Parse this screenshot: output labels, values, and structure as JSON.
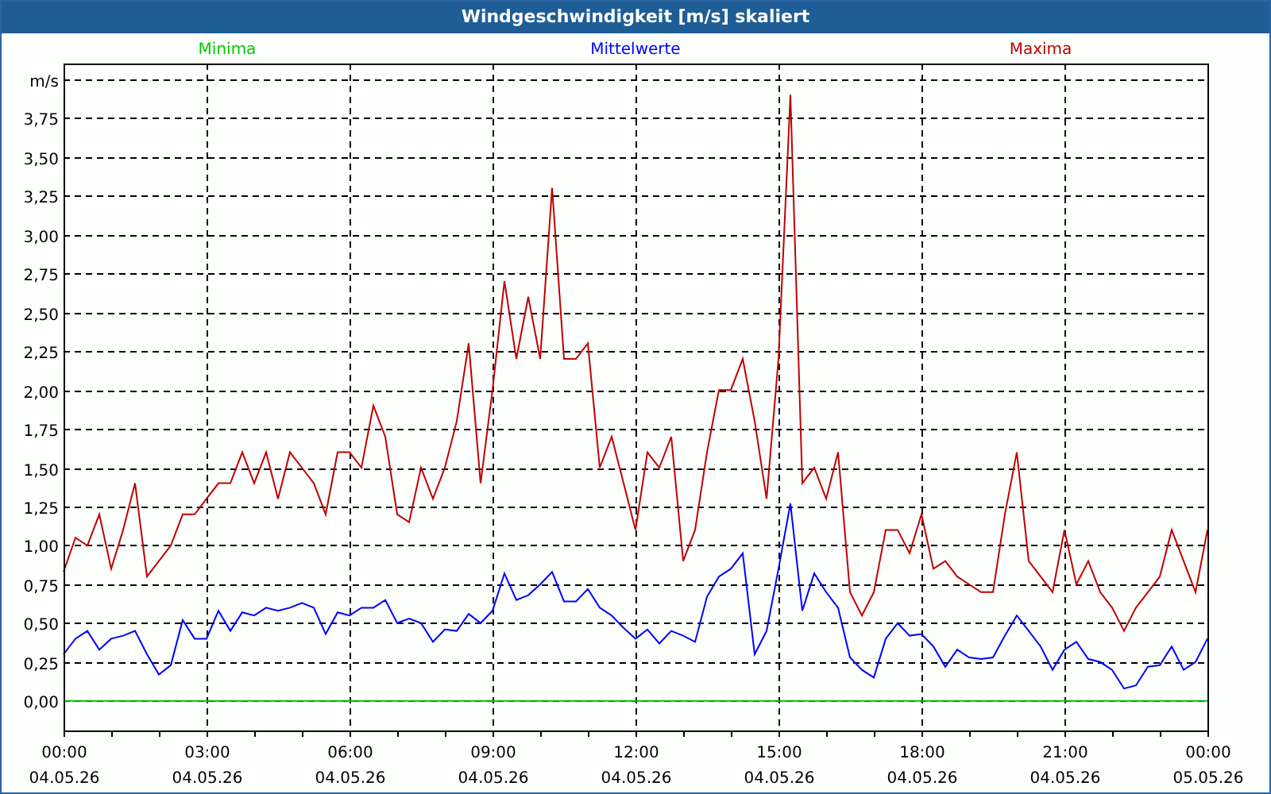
{
  "window": {
    "title": "Windgeschwindigkeit [m/s] skaliert"
  },
  "chart": {
    "chart_data": {
      "type": "line",
      "x": [
        0,
        0.25,
        0.5,
        0.75,
        1,
        1.25,
        1.5,
        1.75,
        2,
        2.25,
        2.5,
        2.75,
        3,
        3.25,
        3.5,
        3.75,
        4,
        4.25,
        4.5,
        4.75,
        5,
        5.25,
        5.5,
        5.75,
        6,
        6.25,
        6.5,
        6.75,
        7,
        7.25,
        7.5,
        7.75,
        8,
        8.25,
        8.5,
        8.75,
        9,
        9.25,
        9.5,
        9.75,
        10,
        10.25,
        10.5,
        10.75,
        11,
        11.25,
        11.5,
        11.75,
        12,
        12.25,
        12.5,
        12.75,
        13,
        13.25,
        13.5,
        13.75,
        14,
        14.25,
        14.5,
        14.75,
        15,
        15.25,
        15.5,
        15.75,
        16,
        16.25,
        16.5,
        16.75,
        17,
        17.25,
        17.5,
        17.75,
        18,
        18.25,
        18.5,
        18.75,
        19,
        19.25,
        19.5,
        19.75,
        20,
        20.25,
        20.5,
        20.75,
        21,
        21.25,
        21.5,
        21.75,
        22,
        22.25,
        22.5,
        22.75,
        23,
        23.25,
        23.5,
        23.75,
        24
      ],
      "series": [
        {
          "name": "Minima",
          "color": "#00c800",
          "values": [
            0,
            0,
            0,
            0,
            0,
            0,
            0,
            0,
            0,
            0,
            0,
            0,
            0,
            0,
            0,
            0,
            0,
            0,
            0,
            0,
            0,
            0,
            0,
            0,
            0,
            0,
            0,
            0,
            0,
            0,
            0,
            0,
            0,
            0,
            0,
            0,
            0,
            0,
            0,
            0,
            0,
            0,
            0,
            0,
            0,
            0,
            0,
            0,
            0,
            0,
            0,
            0,
            0,
            0,
            0,
            0,
            0,
            0,
            0,
            0,
            0,
            0,
            0,
            0,
            0,
            0,
            0,
            0,
            0,
            0,
            0,
            0,
            0,
            0,
            0,
            0,
            0,
            0,
            0,
            0,
            0,
            0,
            0,
            0,
            0,
            0,
            0,
            0,
            0,
            0,
            0,
            0,
            0,
            0,
            0,
            0,
            0
          ]
        },
        {
          "name": "Mittelwerte",
          "color": "#0000ff",
          "values": [
            0.3,
            0.4,
            0.45,
            0.33,
            0.4,
            0.42,
            0.45,
            0.3,
            0.17,
            0.23,
            0.52,
            0.4,
            0.4,
            0.58,
            0.45,
            0.57,
            0.55,
            0.6,
            0.58,
            0.6,
            0.63,
            0.6,
            0.43,
            0.57,
            0.55,
            0.6,
            0.6,
            0.65,
            0.5,
            0.53,
            0.5,
            0.38,
            0.46,
            0.45,
            0.56,
            0.5,
            0.58,
            0.82,
            0.65,
            0.68,
            0.75,
            0.83,
            0.64,
            0.64,
            0.72,
            0.6,
            0.55,
            0.47,
            0.4,
            0.46,
            0.37,
            0.45,
            0.42,
            0.38,
            0.67,
            0.8,
            0.85,
            0.95,
            0.3,
            0.45,
            0.85,
            1.27,
            0.58,
            0.82,
            0.7,
            0.6,
            0.28,
            0.2,
            0.15,
            0.4,
            0.5,
            0.42,
            0.43,
            0.35,
            0.22,
            0.33,
            0.28,
            0.27,
            0.28,
            0.42,
            0.55,
            0.45,
            0.35,
            0.2,
            0.33,
            0.38,
            0.27,
            0.25,
            0.2,
            0.08,
            0.1,
            0.22,
            0.23,
            0.35,
            0.2,
            0.25,
            0.4
          ]
        },
        {
          "name": "Maxima",
          "color": "#c00000",
          "values": [
            0.83,
            1.05,
            1.0,
            1.2,
            0.85,
            1.1,
            1.4,
            0.8,
            0.9,
            1.0,
            1.2,
            1.2,
            1.3,
            1.4,
            1.4,
            1.6,
            1.4,
            1.6,
            1.3,
            1.6,
            1.5,
            1.4,
            1.2,
            1.6,
            1.6,
            1.5,
            1.9,
            1.7,
            1.2,
            1.15,
            1.5,
            1.3,
            1.5,
            1.8,
            2.3,
            1.4,
            2.0,
            2.7,
            2.2,
            2.6,
            2.2,
            3.3,
            2.2,
            2.2,
            2.3,
            1.5,
            1.7,
            1.4,
            1.1,
            1.6,
            1.5,
            1.7,
            0.9,
            1.1,
            1.6,
            2.0,
            2.0,
            2.2,
            1.8,
            1.3,
            2.2,
            3.9,
            1.4,
            1.5,
            1.3,
            1.6,
            0.7,
            0.55,
            0.7,
            1.1,
            1.1,
            0.95,
            1.2,
            0.85,
            0.9,
            0.8,
            0.75,
            0.7,
            0.7,
            1.2,
            1.6,
            0.9,
            0.8,
            0.7,
            1.1,
            0.75,
            0.9,
            0.7,
            0.6,
            0.45,
            0.6,
            0.7,
            0.8,
            1.1,
            0.9,
            0.7,
            1.1
          ]
        }
      ],
      "grid": true,
      "xlim": [
        0,
        24
      ],
      "ylim": [
        -0.19,
        4.1
      ],
      "xticks": [
        {
          "value": 0,
          "label": "00:00"
        },
        {
          "value": 3,
          "label": "03:00"
        },
        {
          "value": 6,
          "label": "06:00"
        },
        {
          "value": 9,
          "label": "09:00"
        },
        {
          "value": 12,
          "label": "12:00"
        },
        {
          "value": 15,
          "label": "15:00"
        },
        {
          "value": 18,
          "label": "18:00"
        },
        {
          "value": 21,
          "label": "21:00"
        },
        {
          "value": 24,
          "label": "00:00"
        }
      ],
      "yticks": [
        {
          "value": 0,
          "label": "0,00"
        },
        {
          "value": 0.25,
          "label": "0,25"
        },
        {
          "value": 0.5,
          "label": "0,50"
        },
        {
          "value": 0.75,
          "label": "0,75"
        },
        {
          "value": 1,
          "label": "1,00"
        },
        {
          "value": 1.25,
          "label": "1,25"
        },
        {
          "value": 1.5,
          "label": "1,50"
        },
        {
          "value": 1.75,
          "label": "1,75"
        },
        {
          "value": 2,
          "label": "2,00"
        },
        {
          "value": 2.25,
          "label": "2,25"
        },
        {
          "value": 2.5,
          "label": "2,50"
        },
        {
          "value": 2.75,
          "label": "2,75"
        },
        {
          "value": 3,
          "label": "3,00"
        },
        {
          "value": 3.25,
          "label": "3,25"
        },
        {
          "value": 3.5,
          "label": "3,50"
        },
        {
          "value": 3.75,
          "label": "3,75"
        },
        {
          "value": 4,
          "label": "m/s"
        }
      ]
    },
    "x_dates": [
      "04.05.26",
      "04.05.26",
      "04.05.26",
      "04.05.26",
      "04.05.26",
      "04.05.26",
      "04.05.26",
      "04.05.26",
      "05.05.26"
    ]
  }
}
